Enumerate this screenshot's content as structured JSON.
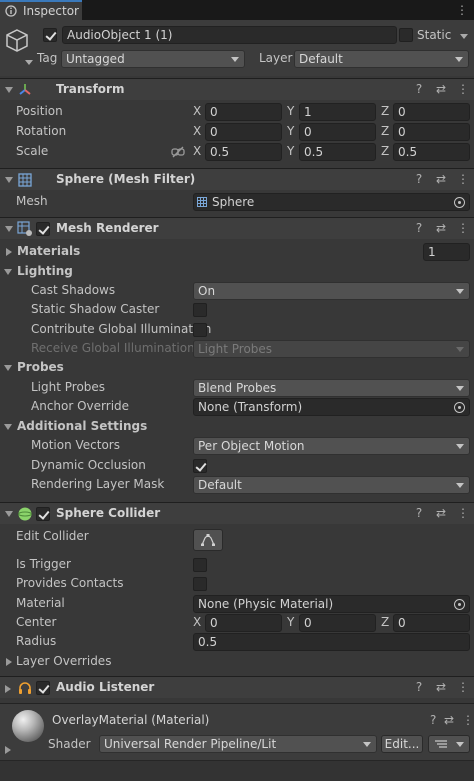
{
  "tab": {
    "label": "Inspector"
  },
  "object": {
    "name": "AudioObject 1 (1)",
    "static_label": "Static",
    "tag_label": "Tag",
    "tag_value": "Untagged",
    "layer_label": "Layer",
    "layer_value": "Default"
  },
  "transform": {
    "title": "Transform",
    "position_label": "Position",
    "rotation_label": "Rotation",
    "scale_label": "Scale",
    "x": "X",
    "y": "Y",
    "z": "Z",
    "position": [
      "0",
      "1",
      "0"
    ],
    "rotation": [
      "0",
      "0",
      "0"
    ],
    "scale": [
      "0.5",
      "0.5",
      "0.5"
    ]
  },
  "mesh_filter": {
    "title": "Sphere (Mesh Filter)",
    "mesh_label": "Mesh",
    "mesh_value": "Sphere"
  },
  "mesh_renderer": {
    "title": "Mesh Renderer",
    "materials_label": "Materials",
    "materials_count": "1",
    "lighting_label": "Lighting",
    "cast_shadows_label": "Cast Shadows",
    "cast_shadows_value": "On",
    "static_shadow_label": "Static Shadow Caster",
    "contribute_gi_label": "Contribute Global Illumination",
    "receive_gi_label": "Receive Global Illumination",
    "receive_gi_value": "Light Probes",
    "probes_label": "Probes",
    "light_probes_label": "Light Probes",
    "light_probes_value": "Blend Probes",
    "anchor_label": "Anchor Override",
    "anchor_value": "None (Transform)",
    "additional_label": "Additional Settings",
    "motion_vectors_label": "Motion Vectors",
    "motion_vectors_value": "Per Object Motion",
    "dynamic_occlusion_label": "Dynamic Occlusion",
    "rendering_layer_label": "Rendering Layer Mask",
    "rendering_layer_value": "Default"
  },
  "sphere_collider": {
    "title": "Sphere Collider",
    "edit_label": "Edit Collider",
    "trigger_label": "Is Trigger",
    "contacts_label": "Provides Contacts",
    "material_label": "Material",
    "material_value": "None (Physic Material)",
    "center_label": "Center",
    "center": [
      "0",
      "0",
      "0"
    ],
    "radius_label": "Radius",
    "radius_value": "0.5",
    "layer_overrides_label": "Layer Overrides"
  },
  "audio_listener": {
    "title": "Audio Listener"
  },
  "material": {
    "title": "OverlayMaterial (Material)",
    "shader_label": "Shader",
    "shader_value": "Universal Render Pipeline/Lit",
    "edit_label": "Edit..."
  },
  "colors": {
    "accent": "#3a79bb",
    "background": "#383838",
    "header": "#3e3e3e",
    "field": "#2a2a2a"
  }
}
